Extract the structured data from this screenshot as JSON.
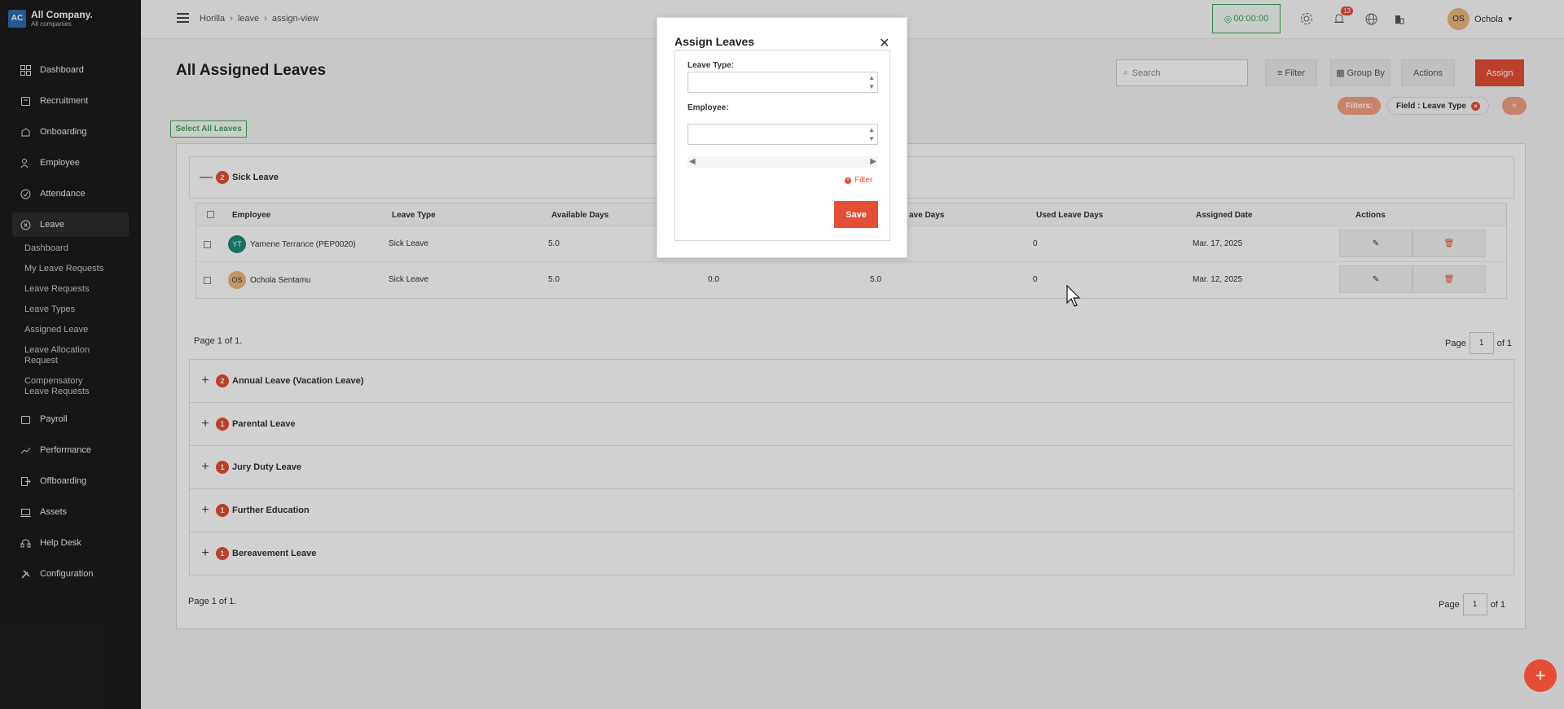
{
  "brand": {
    "logo": "AC",
    "company": "All Company.",
    "subtitle": "All companies"
  },
  "sidebar": {
    "items": [
      {
        "label": "Dashboard",
        "icon": "dashboard-icon"
      },
      {
        "label": "Recruitment",
        "icon": "recruitment-icon"
      },
      {
        "label": "Onboarding",
        "icon": "onboarding-icon"
      },
      {
        "label": "Employee",
        "icon": "employee-icon"
      },
      {
        "label": "Attendance",
        "icon": "attendance-icon"
      },
      {
        "label": "Leave",
        "icon": "leave-icon"
      }
    ],
    "leave_sub": [
      "Dashboard",
      "My Leave Requests",
      "Leave Requests",
      "Leave Types",
      "Assigned Leave",
      "Leave Allocation Request",
      "Compensatory Leave Requests"
    ],
    "bottom_items": [
      {
        "label": "Payroll",
        "icon": "payroll-icon"
      },
      {
        "label": "Performance",
        "icon": "performance-icon"
      },
      {
        "label": "Offboarding",
        "icon": "offboarding-icon"
      },
      {
        "label": "Assets",
        "icon": "assets-icon"
      },
      {
        "label": "Help Desk",
        "icon": "help-desk-icon"
      },
      {
        "label": "Configuration",
        "icon": "configuration-icon"
      }
    ]
  },
  "topbar": {
    "breadcrumb": [
      "Horilla",
      "leave",
      "assign-view"
    ],
    "timer": "00:00:00",
    "notifications": "13",
    "user_initials": "OS",
    "user_name": "Ochola"
  },
  "page": {
    "title": "All Assigned Leaves",
    "search_placeholder": "Search",
    "filter_label": "Filter",
    "group_by_label": "Group By",
    "actions_label": "Actions",
    "assign_label": "Assign",
    "filters_tag": "Filters:",
    "filter_field": "Field : Leave Type",
    "select_all": "Select All Leaves"
  },
  "groups": [
    {
      "name": "Sick Leave",
      "count": "2",
      "expanded": true
    },
    {
      "name": "Annual Leave (Vacation Leave)",
      "count": "2"
    },
    {
      "name": "Parental Leave",
      "count": "1"
    },
    {
      "name": "Jury Duty Leave",
      "count": "1"
    },
    {
      "name": "Further Education",
      "count": "1"
    },
    {
      "name": "Bereavement Leave",
      "count": "1"
    }
  ],
  "table": {
    "headers": [
      "Employee",
      "Leave Type",
      "Available Days",
      "ave Days",
      "Used Leave Days",
      "Assigned Date",
      "Actions"
    ],
    "rows": [
      {
        "initials": "YT",
        "employee": "Yamene Terrance (PEP0020)",
        "leave_type": "Sick Leave",
        "available": "5.0",
        "col4": "",
        "col5": "",
        "used": "0",
        "date": "Mar. 17, 2025",
        "av_color": "#1e8a7a"
      },
      {
        "initials": "OS",
        "employee": "Ochola Sentamu",
        "leave_type": "Sick Leave",
        "available": "5.0",
        "col4": "0.0",
        "col5": "5.0",
        "used": "0",
        "date": "Mar. 12, 2025",
        "av_color": "#e9b77d"
      }
    ]
  },
  "pagination": {
    "inner_info": "Page 1 of 1.",
    "outer_info": "Page 1 of 1.",
    "page_word": "Page",
    "current": "1",
    "of_text": "of 1"
  },
  "modal": {
    "title": "Assign Leaves",
    "leave_type_label": "Leave Type:",
    "employee_label": "Employee:",
    "filter_link": "Filter",
    "save": "Save"
  }
}
